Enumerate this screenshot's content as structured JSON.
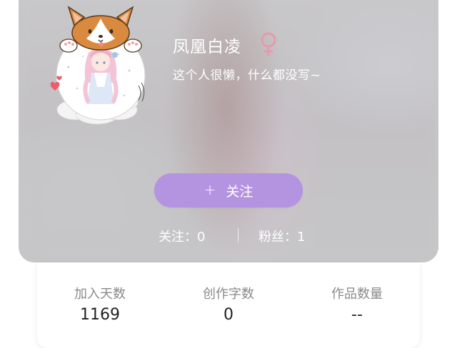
{
  "profile": {
    "username": "凤凰白凌",
    "gender_icon": "female-symbol-icon",
    "gender_color": "#e79aac",
    "bio": "这个人很懒，什么都没写~",
    "follow_button": {
      "icon": "+",
      "label": "关注",
      "color": "#b493e0"
    },
    "following": "关注：0",
    "fans": "粉丝：1"
  },
  "stats": [
    {
      "label": "加入天数",
      "value": "1169"
    },
    {
      "label": "创作字数",
      "value": "0"
    },
    {
      "label": "作品数量",
      "value": "--"
    }
  ]
}
